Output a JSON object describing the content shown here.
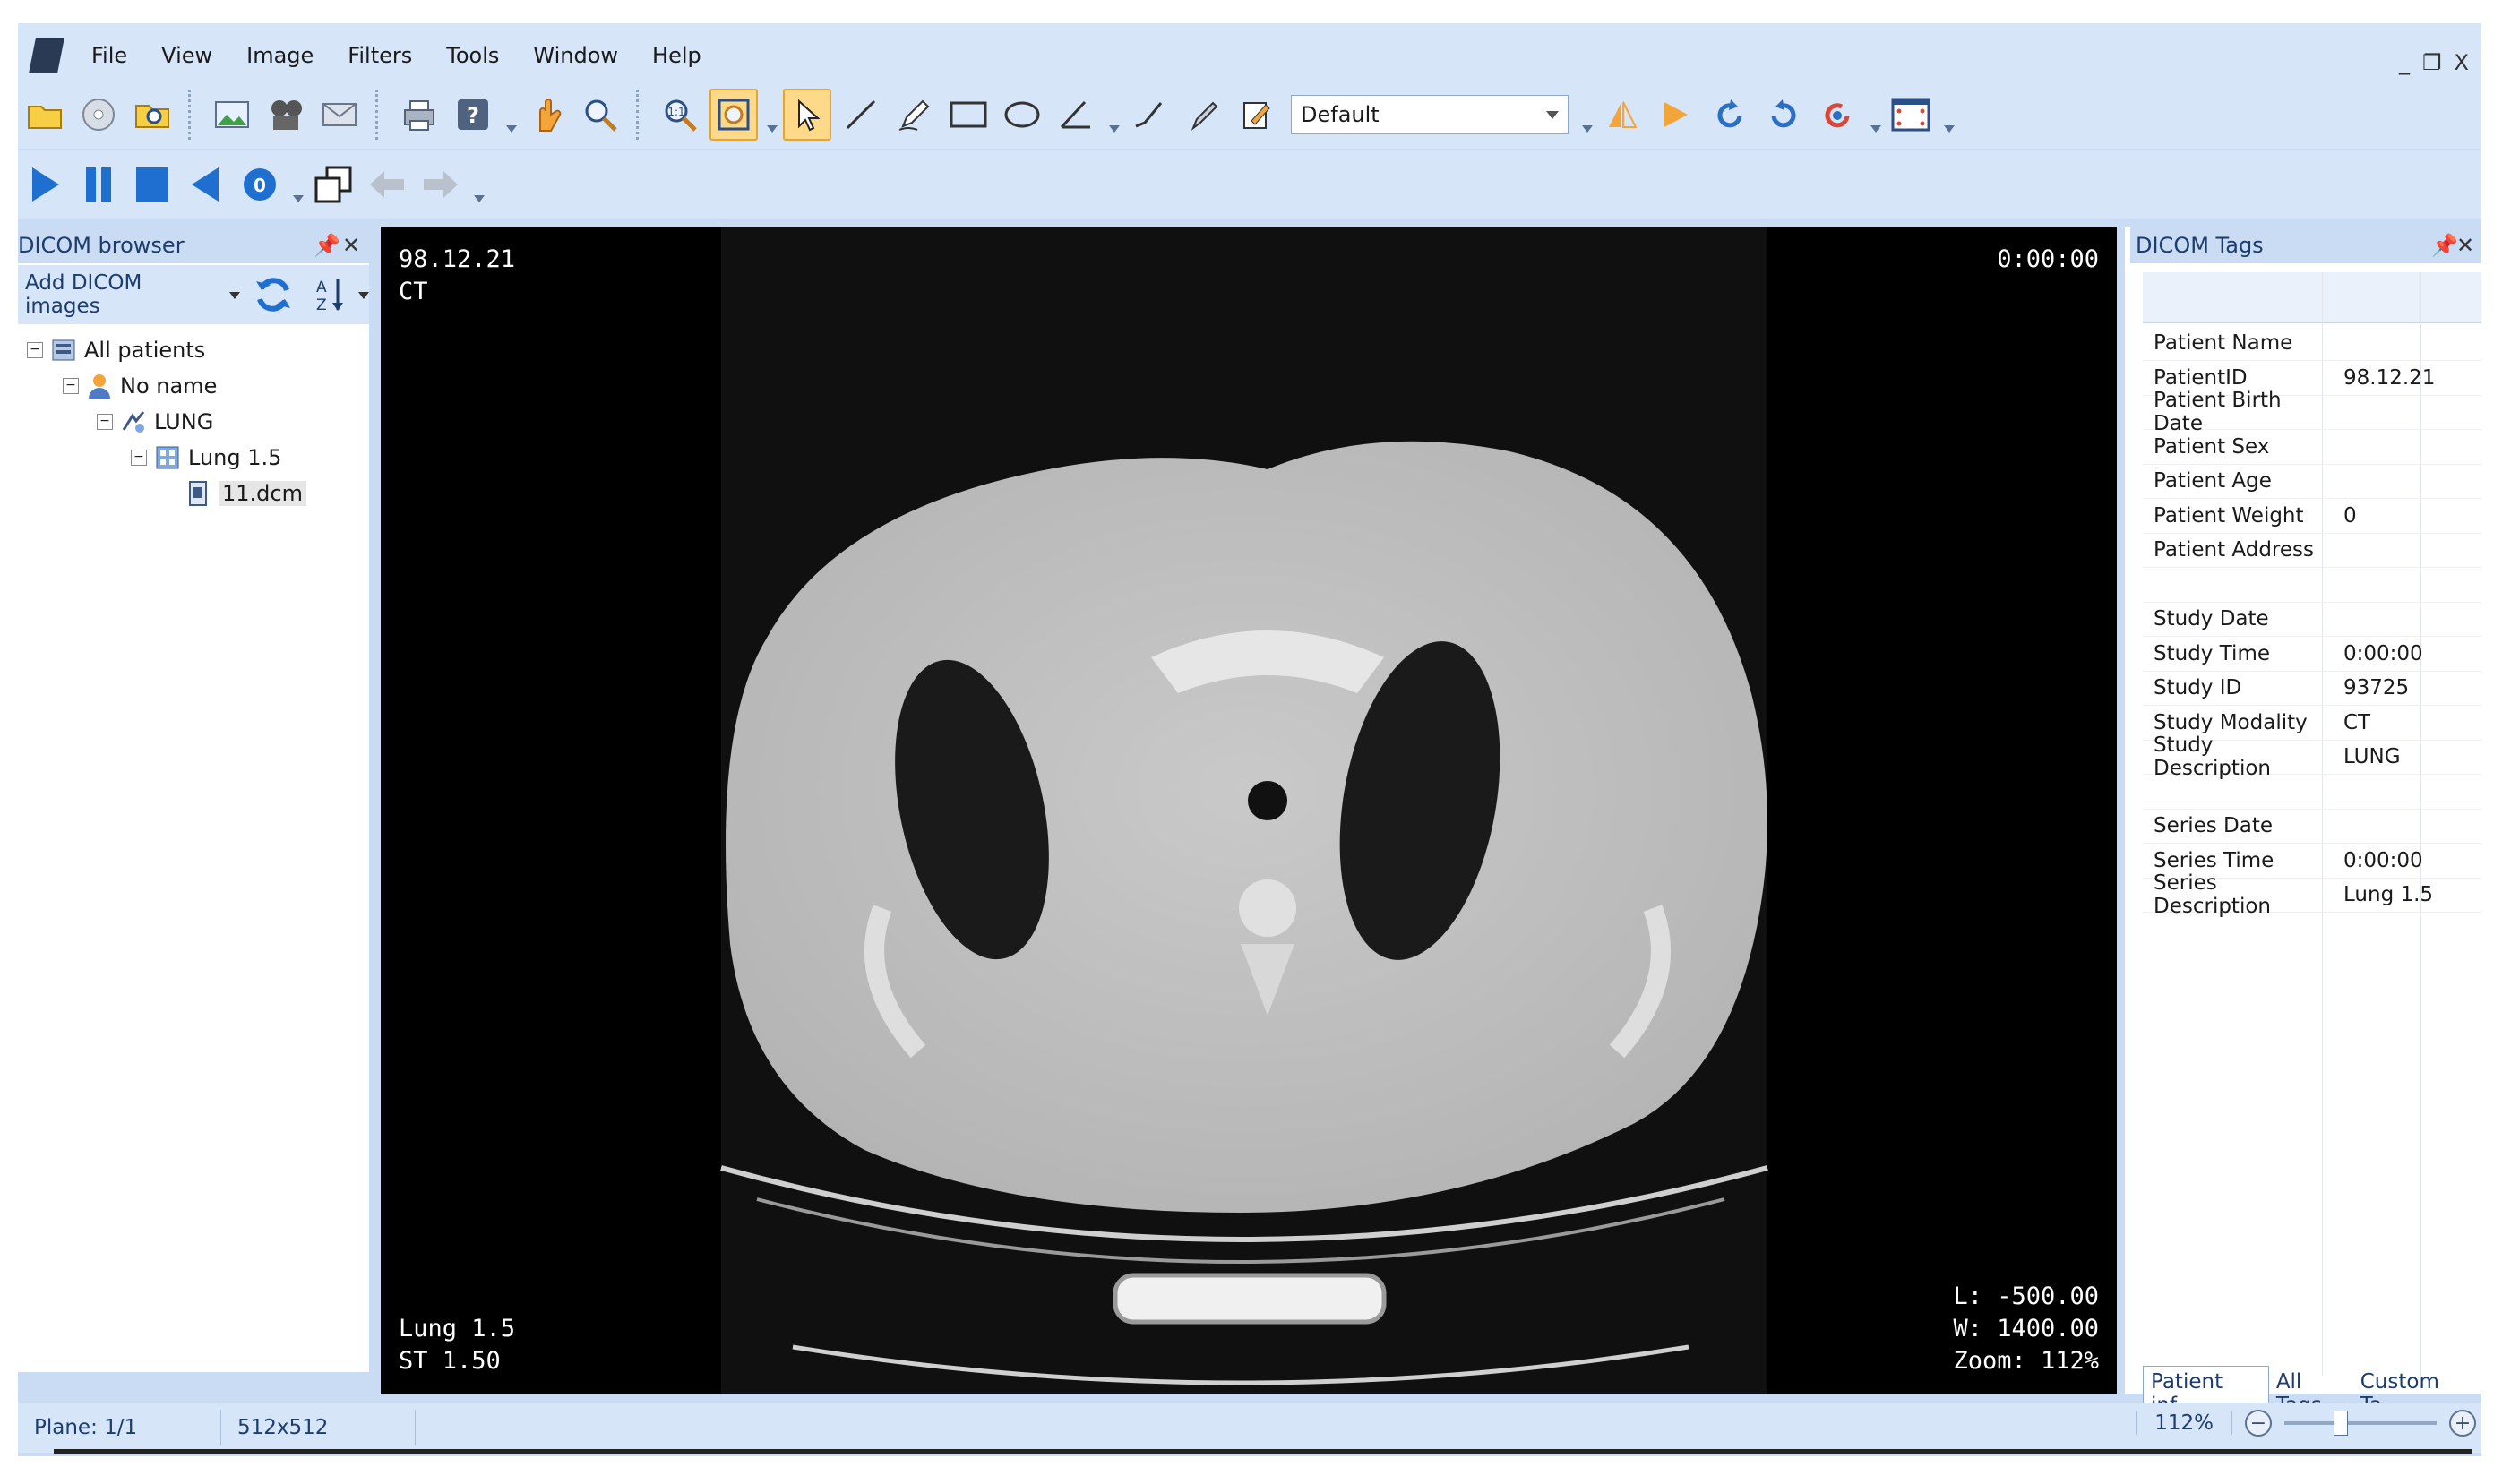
{
  "menu": {
    "items": [
      "File",
      "View",
      "Image",
      "Filters",
      "Tools",
      "Window",
      "Help"
    ]
  },
  "window_controls": {
    "minimize": "_",
    "restore": "❐",
    "close": "X"
  },
  "toolbar": {
    "preset_value": "Default"
  },
  "dicom_browser": {
    "title": "DICOM browser",
    "add_images_label": "Add DICOM images",
    "tree": [
      {
        "label": "All patients",
        "level": 0,
        "icon": "patients-icon"
      },
      {
        "label": "No name",
        "level": 1,
        "icon": "patient-icon"
      },
      {
        "label": "LUNG",
        "level": 2,
        "icon": "study-icon"
      },
      {
        "label": "Lung 1.5",
        "level": 3,
        "icon": "series-icon"
      },
      {
        "label": "11.dcm",
        "level": 4,
        "icon": "dicom-file-icon"
      }
    ]
  },
  "viewer": {
    "top_left": [
      "98.12.21",
      "CT"
    ],
    "top_right": "0:00:00",
    "bottom_left": [
      "Lung 1.5",
      "ST 1.50"
    ],
    "bottom_right": [
      "L: -500.00",
      "W: 1400.00",
      "Zoom: 112%"
    ]
  },
  "dicom_tags": {
    "title": "DICOM Tags",
    "rows": [
      {
        "key": "Patient Name",
        "value": ""
      },
      {
        "key": "PatientID",
        "value": "98.12.21"
      },
      {
        "key": "Patient Birth Date",
        "value": ""
      },
      {
        "key": "Patient Sex",
        "value": ""
      },
      {
        "key": "Patient Age",
        "value": ""
      },
      {
        "key": "Patient Weight",
        "value": "0"
      },
      {
        "key": "Patient Address",
        "value": ""
      },
      {
        "key": "",
        "value": ""
      },
      {
        "key": "Study Date",
        "value": ""
      },
      {
        "key": "Study Time",
        "value": "0:00:00"
      },
      {
        "key": "Study ID",
        "value": "93725"
      },
      {
        "key": "Study Modality",
        "value": "CT"
      },
      {
        "key": "Study Description",
        "value": "LUNG"
      },
      {
        "key": "",
        "value": ""
      },
      {
        "key": "Series Date",
        "value": ""
      },
      {
        "key": "Series Time",
        "value": "0:00:00"
      },
      {
        "key": "Series Description",
        "value": "Lung 1.5"
      }
    ],
    "tabs": [
      "Patient inf...",
      "All Tags",
      "Custom Ta..."
    ]
  },
  "status": {
    "plane": "Plane: 1/1",
    "size": "512x512",
    "zoom": "112%",
    "zoom_fraction": 0.35
  },
  "colors": {
    "panel_bg": "#c9dcf3",
    "toolbar_bg": "#d6e5f8",
    "accent_active": "#ffd98a",
    "title_text": "#1c3d6e"
  }
}
